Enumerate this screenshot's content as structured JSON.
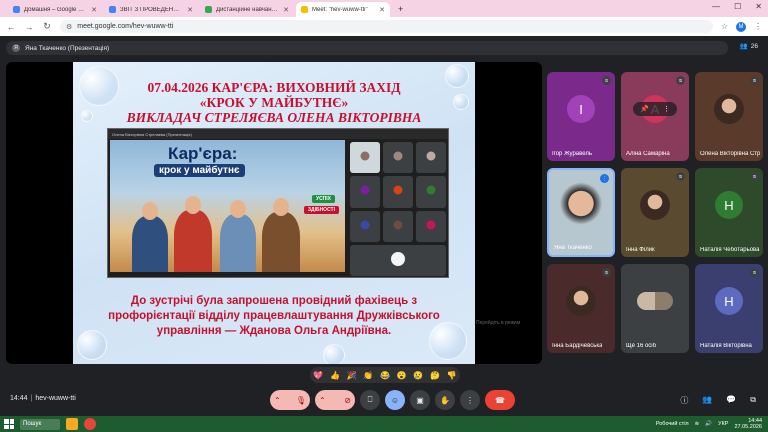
{
  "browser": {
    "tabs": [
      {
        "title": "Домашня – Google Диск",
        "color": "#4285f4"
      },
      {
        "title": "ЗВІТ З ПРОВЕДЕННЯ ТИЖНЯ",
        "color": "#4285f4"
      },
      {
        "title": "Дистанційне навчання в ВСП",
        "color": "#34a853"
      },
      {
        "title": "Meet: \"hev-wuww-tti\"",
        "color": "#fbbc04",
        "active": true
      }
    ],
    "new_tab": "+",
    "url": "meet.google.com/hev-wuww-tti",
    "profile_letter": "М"
  },
  "meet": {
    "presenter_pill": "Яна Ткаченко (Презентація)",
    "presenter_initial": "Я",
    "participant_count": "26",
    "slide": {
      "title_line1": "07.04.2026 КАР'ЄРА: ВИХОВНИЙ ЗАХІД",
      "title_line2": "«КРОК У МАЙБУТНЄ»",
      "title_line3": "ВИКЛАДАЧ СТРЕЛЯЄВА ОЛЕНА ВІКТОРІВНА",
      "inner_header": "Олена Вікторівна Стреляєва (Презентація)",
      "inner_kar": "Кар'єра:",
      "inner_krok": "крок у майбутнє",
      "inner_uspih": "УСПІХ",
      "inner_zdib": "ЗДІБНОСТІ",
      "body": "До зустрічі була запрошена провідний фахівець з профорієнтації відділу працевлаштування Дружківського управління — Жданова Ольга Андріївна."
    },
    "stage_hint": "Перейдіть в режим",
    "participants": [
      {
        "name": "Ігор Журавель",
        "letter": "І",
        "bg": "#7b2a8c",
        "avatar": "#a142b8",
        "muted": true
      },
      {
        "name": "Аліна Самаріна",
        "letter": "A",
        "bg": "#8a3a5a",
        "avatar": "#d0345c",
        "muted": true,
        "hover": true
      },
      {
        "name": "Олена Вікторівна Стреляєва",
        "letter": "",
        "bg": "#5a3a2a",
        "avatar": "photo",
        "muted": true
      },
      {
        "name": "Яна Ткаченко",
        "letter": "",
        "bg": "#b7c7cf",
        "avatar": "video",
        "muted": false,
        "speaking": true
      },
      {
        "name": "Інна Філик",
        "letter": "",
        "bg": "#5a4a30",
        "avatar": "photo",
        "muted": true
      },
      {
        "name": "Наталія Чеботарьова",
        "letter": "Н",
        "bg": "#2e4a2a",
        "avatar": "#2e7d32",
        "muted": true
      },
      {
        "name": "Інна Бардічевська",
        "letter": "",
        "bg": "#4a2a2a",
        "avatar": "photo",
        "muted": true
      },
      {
        "name": "Ще 16 осіб",
        "letter": "",
        "bg": "#3c4043",
        "avatar": "group",
        "muted": false
      },
      {
        "name": "Наталія Вікторівна",
        "letter": "Н",
        "bg": "#3a3f70",
        "avatar": "#5c6bc0",
        "muted": true
      }
    ],
    "reactions": [
      "💖",
      "👍",
      "🎉",
      "👏",
      "😂",
      "😮",
      "😢",
      "🤔",
      "👎"
    ],
    "time": "14:44",
    "meeting_code": "hev-wuww-tti"
  },
  "taskbar": {
    "search_label": "Пошук",
    "tray_text": "Робочий стіл",
    "lang": "УКР",
    "clock_time": "14:44",
    "clock_date": "27.05.2026"
  }
}
